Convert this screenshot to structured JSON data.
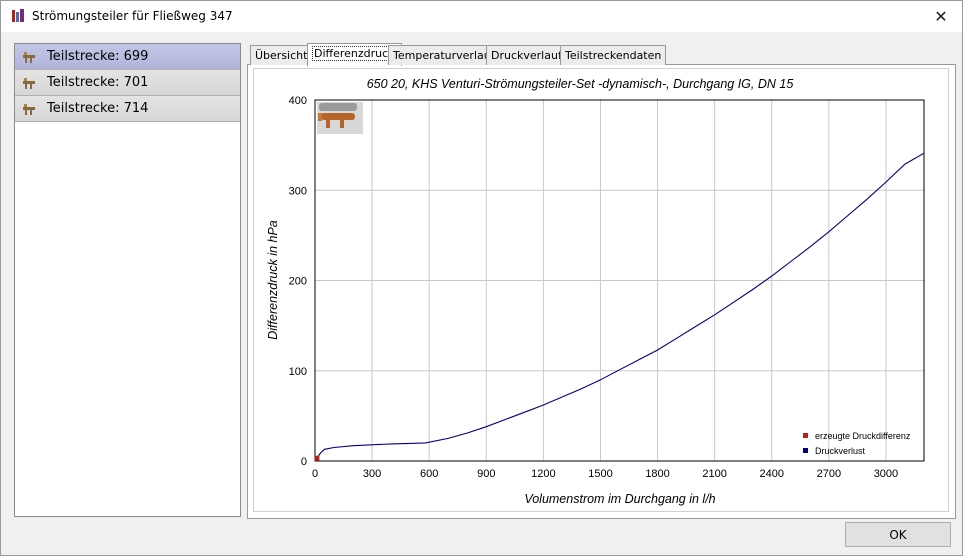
{
  "window": {
    "title": "Strömungsteiler für Fließweg 347"
  },
  "sidebar": {
    "items": [
      {
        "label": "Teilstrecke: 699",
        "selected": true
      },
      {
        "label": "Teilstrecke: 701",
        "selected": false
      },
      {
        "label": "Teilstrecke: 714",
        "selected": false
      }
    ]
  },
  "tabs": [
    {
      "label": "Übersicht"
    },
    {
      "label": "Differenzdruck",
      "active": true
    },
    {
      "label": "Temperaturverlauf"
    },
    {
      "label": "Druckverlauf"
    },
    {
      "label": "Teilstreckendaten"
    }
  ],
  "buttons": {
    "ok": "OK"
  },
  "chart_data": {
    "type": "line",
    "title": "650 20, KHS Venturi-Strömungsteiler-Set -dynamisch-, Durchgang IG, DN 15",
    "xlabel": "Volumenstrom im Durchgang in l/h",
    "ylabel": "Differenzdruck in hPa",
    "xlim": [
      0,
      3200
    ],
    "ylim": [
      0,
      400
    ],
    "xticks": [
      0,
      300,
      600,
      900,
      1200,
      1500,
      1800,
      2100,
      2400,
      2700,
      3000
    ],
    "yticks": [
      0,
      100,
      200,
      300,
      400
    ],
    "grid": true,
    "legend_position": "bottom-right",
    "series": [
      {
        "name": "erzeugte Druckdifferenz",
        "color": "#b22222",
        "points": [
          [
            10,
            3
          ]
        ]
      },
      {
        "name": "Druckverlust",
        "color": "#000080",
        "points": [
          [
            0,
            0
          ],
          [
            15,
            5
          ],
          [
            30,
            9
          ],
          [
            50,
            13
          ],
          [
            100,
            15
          ],
          [
            200,
            17
          ],
          [
            300,
            18
          ],
          [
            400,
            19
          ],
          [
            500,
            19.5
          ],
          [
            580,
            20
          ],
          [
            700,
            25
          ],
          [
            800,
            31
          ],
          [
            900,
            38
          ],
          [
            1000,
            46
          ],
          [
            1100,
            54
          ],
          [
            1200,
            62
          ],
          [
            1300,
            71
          ],
          [
            1400,
            80
          ],
          [
            1500,
            90
          ],
          [
            1600,
            101
          ],
          [
            1700,
            112
          ],
          [
            1800,
            123
          ],
          [
            1900,
            136
          ],
          [
            2000,
            149
          ],
          [
            2100,
            162
          ],
          [
            2200,
            176
          ],
          [
            2300,
            190
          ],
          [
            2400,
            205
          ],
          [
            2500,
            221
          ],
          [
            2600,
            237
          ],
          [
            2700,
            254
          ],
          [
            2800,
            272
          ],
          [
            2900,
            290
          ],
          [
            3000,
            309
          ],
          [
            3100,
            329
          ],
          [
            3200,
            341
          ]
        ]
      }
    ]
  }
}
